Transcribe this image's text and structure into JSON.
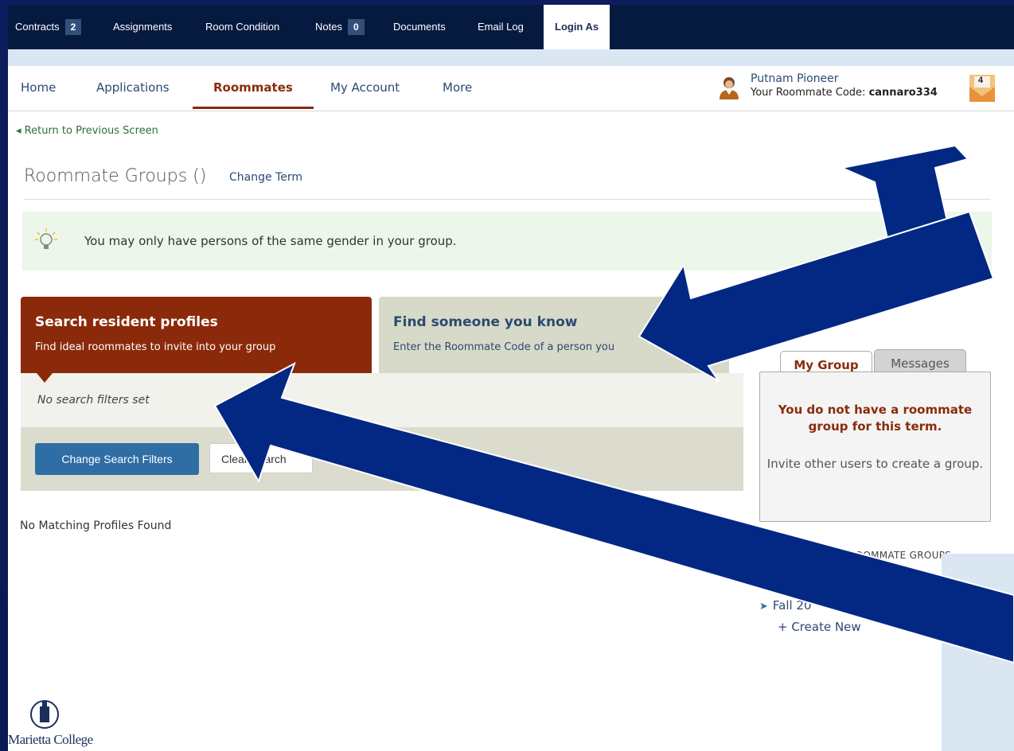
{
  "admin_bar": {
    "tabs": [
      {
        "label": "Contracts",
        "count": "2"
      },
      {
        "label": "Assignments"
      },
      {
        "label": "Room Condition"
      },
      {
        "label": "Notes",
        "count": "0"
      },
      {
        "label": "Documents"
      },
      {
        "label": "Email Log"
      },
      {
        "label": "Login As",
        "active": true
      }
    ]
  },
  "nav": {
    "items": [
      "Home",
      "Applications",
      "Roommates",
      "My Account",
      "More"
    ],
    "active": "Roommates"
  },
  "user": {
    "name": "Putnam Pioneer",
    "code_label": "Your Roommate Code: ",
    "code": "cannaro334",
    "mail_count": "4"
  },
  "back_link": "◂ Return to Previous Screen",
  "page": {
    "title": "Roommate Groups ()",
    "change_term": "Change Term"
  },
  "notice": {
    "text": "You may only have persons of the same gender in your group."
  },
  "cards": {
    "search": {
      "heading": "Search resident profiles",
      "text": "Find ideal roommates to invite into your group"
    },
    "find": {
      "heading": "Find someone you know",
      "text": "Enter the Roommate Code of a person you"
    }
  },
  "filters": {
    "status": "No search filters set",
    "change_button": "Change Search Filters",
    "clear_button": "Clear Search"
  },
  "results": {
    "empty": "No Matching Profiles Found"
  },
  "sidebar": {
    "tabs": [
      "My Group",
      "Messages"
    ],
    "warning": "You do not have a roommate group for this term.",
    "info": "Invite other users to create a group.",
    "groups_heading": "ROOMMATE GROUPS",
    "group_item": "Fall 20",
    "create_new": "+ Create New"
  },
  "logo": {
    "text": "Marietta College"
  },
  "colors": {
    "slide_bg": "#0b1d5e",
    "admin_bar": "#061a3f",
    "accent_rust": "#8b2a0a",
    "link_blue": "#2c4a70",
    "primary_button": "#2f6ea5",
    "arrow_fill": "#032883"
  }
}
